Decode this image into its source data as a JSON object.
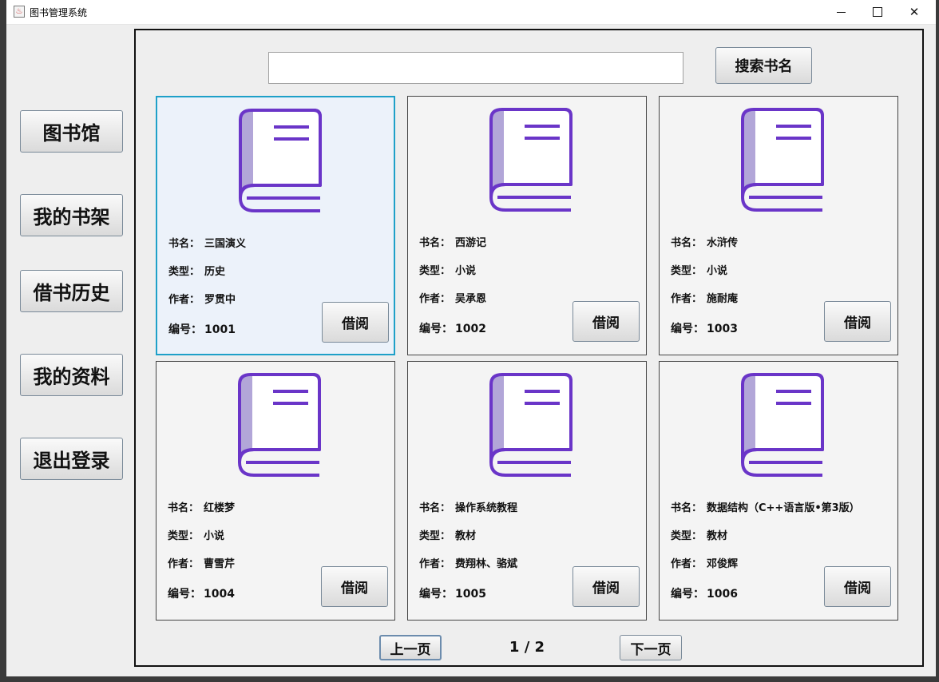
{
  "window": {
    "title": "图书管理系统"
  },
  "sidebar": {
    "items": [
      {
        "label": "图书馆"
      },
      {
        "label": "我的书架"
      },
      {
        "label": "借书历史"
      },
      {
        "label": "我的资料"
      },
      {
        "label": "退出登录"
      }
    ]
  },
  "search": {
    "value": "",
    "button_label": "搜索书名"
  },
  "field_labels": {
    "name": "书名：",
    "type": "类型：",
    "author": "作者：",
    "id": "编号："
  },
  "books": [
    {
      "name": "三国演义",
      "type": "历史",
      "author": "罗贯中",
      "id": "1001",
      "button": "借阅",
      "selected": true
    },
    {
      "name": "西游记",
      "type": "小说",
      "author": "吴承恩",
      "id": "1002",
      "button": "借阅"
    },
    {
      "name": "水浒传",
      "type": "小说",
      "author": "施耐庵",
      "id": "1003",
      "button": "借阅"
    },
    {
      "name": "红楼梦",
      "type": "小说",
      "author": "曹雪芹",
      "id": "1004",
      "button": "借阅"
    },
    {
      "name": "操作系统教程",
      "type": "教材",
      "author": "费翔林、骆斌",
      "id": "1005",
      "button": "借阅"
    },
    {
      "name": "数据结构（C++语言版•第3版）",
      "type": "教材",
      "author": "邓俊辉",
      "id": "1006",
      "button": "借阅"
    }
  ],
  "pagination": {
    "prev_label": "上一页",
    "next_label": "下一页",
    "indicator": "1 / 2"
  },
  "colors": {
    "book_icon": "#6a35c8",
    "book_spine": "#b2a6d8",
    "selected_border": "#1ea0c8"
  }
}
